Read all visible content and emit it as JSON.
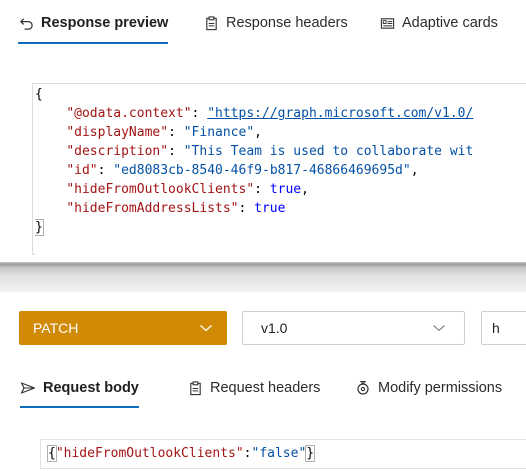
{
  "response_tabs": [
    {
      "label": "Response preview",
      "icon": "undo-arrow-icon",
      "active": true
    },
    {
      "label": "Response headers",
      "icon": "clipboard-icon",
      "active": false
    },
    {
      "label": "Adaptive cards",
      "icon": "card-icon",
      "active": false
    }
  ],
  "response_json": {
    "open_brace": "{",
    "close_brace": "}",
    "lines": [
      {
        "key": "\"@odata.context\"",
        "value": "\"https://graph.microsoft.com/v1.0/",
        "value_type": "url",
        "trail": ""
      },
      {
        "key": "\"displayName\"",
        "value": "\"Finance\"",
        "value_type": "string",
        "trail": ","
      },
      {
        "key": "\"description\"",
        "value": "\"This Team is used to collaborate wit",
        "value_type": "string",
        "trail": ""
      },
      {
        "key": "\"id\"",
        "value": "\"ed8083cb-8540-46f9-b817-46866469695d\"",
        "value_type": "string",
        "trail": ","
      },
      {
        "key": "\"hideFromOutlookClients\"",
        "value": "true",
        "value_type": "bool",
        "trail": ","
      },
      {
        "key": "\"hideFromAddressLists\"",
        "value": "true",
        "value_type": "bool",
        "trail": ""
      }
    ]
  },
  "request": {
    "method": "PATCH",
    "version": "v1.0",
    "url_partial": "h",
    "tabs": [
      {
        "label": "Request body",
        "icon": "send-arrow-icon",
        "active": true
      },
      {
        "label": "Request headers",
        "icon": "clipboard-icon",
        "active": false
      },
      {
        "label": "Modify permissions",
        "icon": "key-shield-icon",
        "active": false
      }
    ],
    "body": {
      "open": "{",
      "key": "\"hideFromOutlookClients\"",
      "colon": ":",
      "value": "\"false\"",
      "close": "}"
    }
  },
  "colors": {
    "accent": "#0f6cbd",
    "method_bg": "#d08a06",
    "json_key": "#a31515",
    "json_string": "#0451a5",
    "json_bool": "#0000ff"
  }
}
